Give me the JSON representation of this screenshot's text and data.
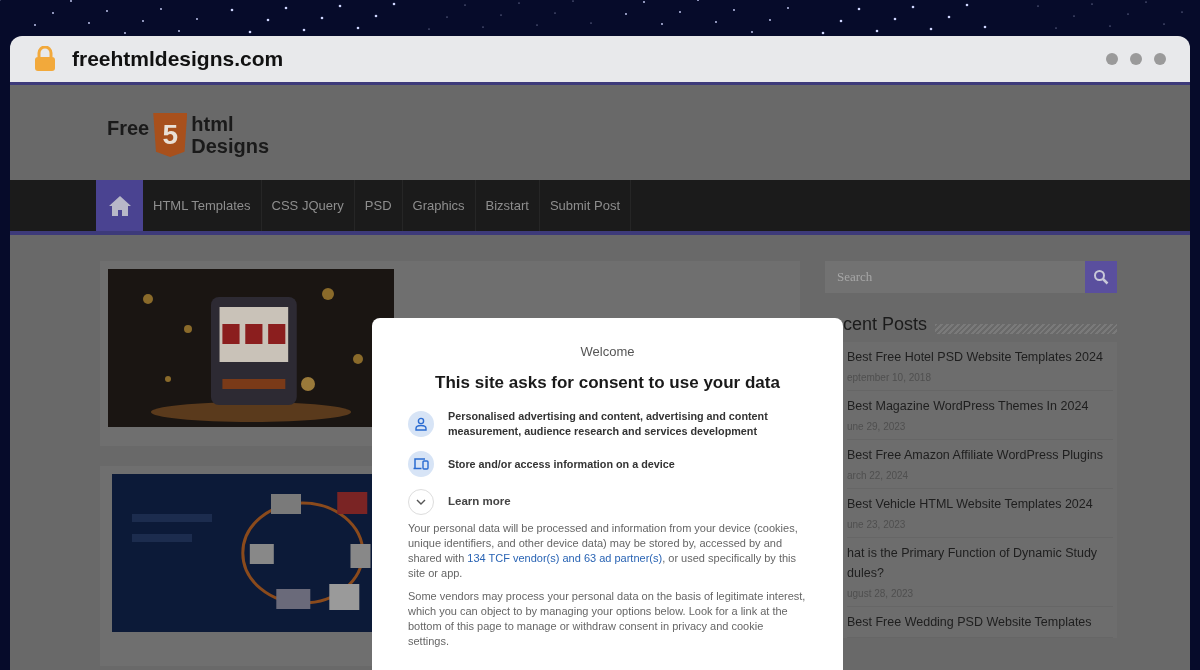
{
  "browser": {
    "url": "freehtmldesigns.com"
  },
  "logo": {
    "left": "Free",
    "badge": "5",
    "right_top": "html",
    "right_bottom": "Designs"
  },
  "nav": {
    "home_selected": true,
    "items": [
      {
        "label": "HTML Templates",
        "selected": false
      },
      {
        "label": "CSS JQuery",
        "selected": false
      },
      {
        "label": "PSD",
        "selected": false
      },
      {
        "label": "Graphics",
        "selected": false
      },
      {
        "label": "Bizstart",
        "selected": false
      },
      {
        "label": "Submit Post",
        "selected": false
      }
    ]
  },
  "sidebar": {
    "search_placeholder": "Search",
    "recent_heading": "cent Posts",
    "recent": [
      {
        "title": "Best Free Hotel PSD Website Templates 2024",
        "date": "eptember 10, 2018"
      },
      {
        "title": "Best Magazine WordPress Themes In 2024",
        "date": "une 29, 2023"
      },
      {
        "title": "Best Free Amazon Affiliate WordPress Plugins",
        "date": "arch 22, 2024"
      },
      {
        "title": "Best Vehicle HTML Website Templates 2024",
        "date": "une 23, 2023"
      },
      {
        "title": "hat is the Primary Function of Dynamic Study dules?",
        "date": "ugust 28, 2023"
      },
      {
        "title": "Best Free Wedding PSD Website Templates"
      }
    ]
  },
  "consent": {
    "welcome": "Welcome",
    "title": "This site asks for consent to use your data",
    "purposes": [
      {
        "kind": "person",
        "text": "Personalised advertising and content, advertising and content measurement, audience research and services development"
      },
      {
        "kind": "device",
        "text": "Store and/or access information on a device"
      }
    ],
    "learn_more": {
      "label": "Learn more",
      "expanded": false
    },
    "paragraph_1": {
      "before": "Your personal data will be processed and information from your device (cookies, unique identifiers, and other device data) may be stored by, accessed by and shared with ",
      "link": "134 TCF vendor(s) and 63 ad partner(s)",
      "after": ", or used specifically by this site or app."
    },
    "paragraph_2": "Some vendors may process your personal data on the basis of legitimate interest, which you can object to by managing your options below. Look for a link at the bottom of this page to manage or withdraw consent in privacy and cookie settings."
  }
}
